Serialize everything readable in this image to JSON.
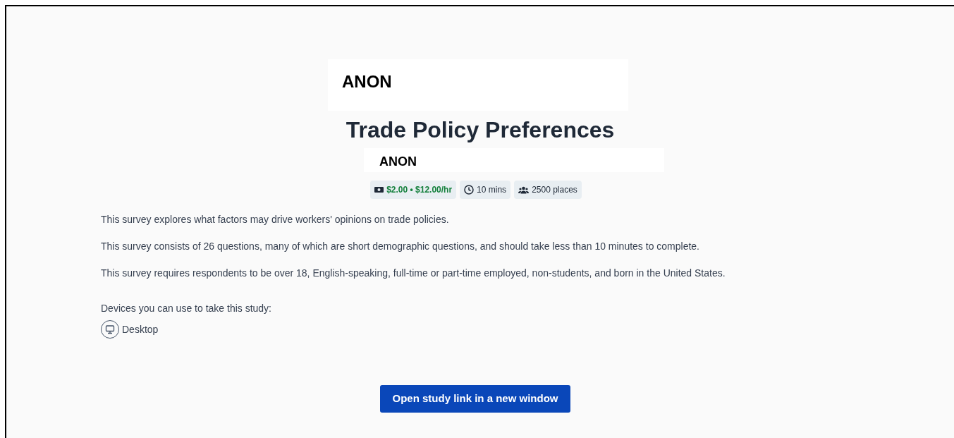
{
  "header_label": "ANON",
  "title": "Trade Policy Preferences",
  "subtitle_label": "ANON",
  "badges": [
    {
      "kind": "reward",
      "text": "$2.00 • $12.00/hr"
    },
    {
      "kind": "time",
      "text": "10 mins"
    },
    {
      "kind": "places",
      "text": "2500 places"
    }
  ],
  "description": [
    "This survey explores what factors may drive workers' opinions on trade policies.",
    "This survey consists of 26 questions, many of which are short demographic questions, and should take less than 10 minutes to complete.",
    "This survey requires respondents to be over 18, English-speaking, full-time or part-time employed, non-students, and born in the United States."
  ],
  "devices_label": "Devices you can use to take this study:",
  "devices": [
    {
      "kind": "desktop",
      "label": "Desktop"
    }
  ],
  "button": "Open study link in a new window"
}
